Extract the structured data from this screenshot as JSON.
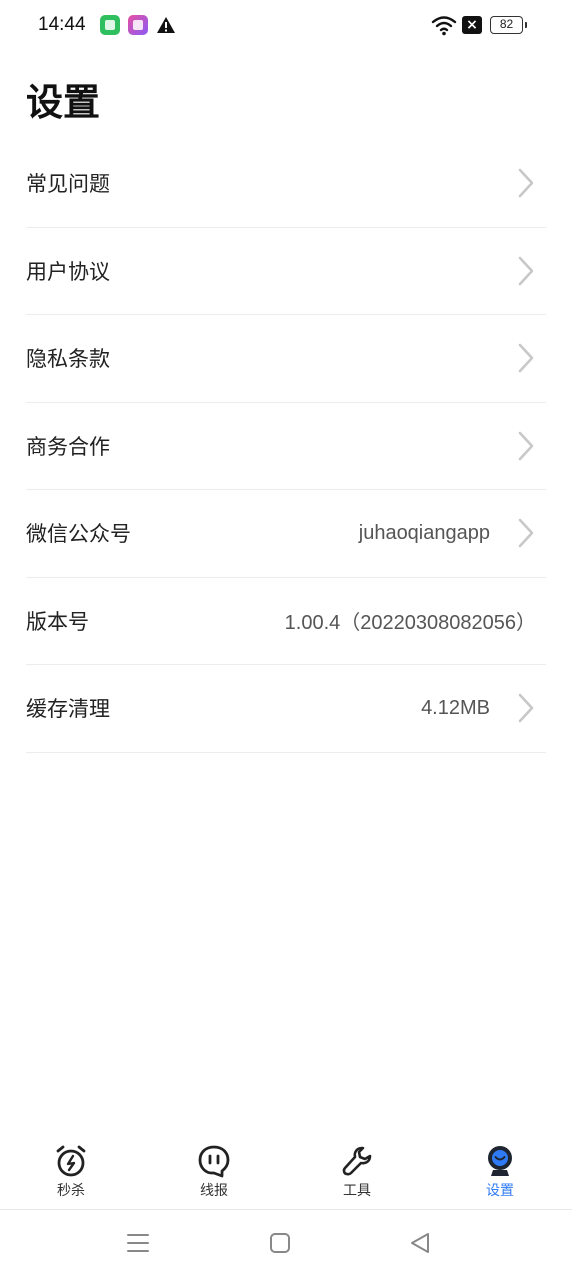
{
  "status_bar": {
    "time": "14:44",
    "battery": "82"
  },
  "page": {
    "title": "设置"
  },
  "settings": {
    "items": [
      {
        "label": "常见问题",
        "value": "",
        "arrow": true
      },
      {
        "label": "用户协议",
        "value": "",
        "arrow": true
      },
      {
        "label": "隐私条款",
        "value": "",
        "arrow": true
      },
      {
        "label": "商务合作",
        "value": "",
        "arrow": true
      },
      {
        "label": "微信公众号",
        "value": "juhaoqiangapp",
        "arrow": true
      },
      {
        "label": "版本号",
        "value": "1.00.4（20220308082056）",
        "arrow": false
      },
      {
        "label": "缓存清理",
        "value": "4.12MB",
        "arrow": true
      }
    ]
  },
  "tabs": [
    {
      "label": "秒杀",
      "icon": "alarm-clock-icon"
    },
    {
      "label": "线报",
      "icon": "chat-bubble-icon"
    },
    {
      "label": "工具",
      "icon": "wrench-icon"
    },
    {
      "label": "设置",
      "icon": "profile-face-icon",
      "active": true
    }
  ],
  "colors": {
    "accent": "#2f7bf5",
    "divider": "#ececec",
    "chevron": "#c8c8c8"
  }
}
